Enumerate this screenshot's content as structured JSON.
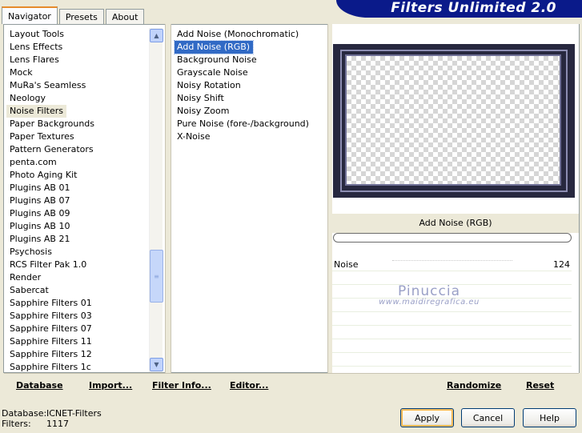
{
  "tabs": [
    {
      "label": "Navigator",
      "active": true
    },
    {
      "label": "Presets",
      "active": false
    },
    {
      "label": "About",
      "active": false
    }
  ],
  "banner": {
    "title": "Filters Unlimited 2.0",
    "color": "#0a1a8a"
  },
  "categories": [
    "Layout Tools",
    "Lens Effects",
    "Lens Flares",
    "Mock",
    "MuRa's Seamless",
    "Neology",
    "Noise Filters",
    "Paper Backgrounds",
    "Paper Textures",
    "Pattern Generators",
    "penta.com",
    "Photo Aging Kit",
    "Plugins AB 01",
    "Plugins AB 07",
    "Plugins AB 09",
    "Plugins AB 10",
    "Plugins AB 21",
    "Psychosis",
    "RCS Filter Pak 1.0",
    "Render",
    "Sabercat",
    "Sapphire Filters 01",
    "Sapphire Filters 03",
    "Sapphire Filters 07",
    "Sapphire Filters 11",
    "Sapphire Filters 12",
    "Sapphire Filters 1c"
  ],
  "selected_category": "Noise Filters",
  "filters": [
    "Add Noise (Monochromatic)",
    "Add Noise (RGB)",
    "Background Noise",
    "Grayscale Noise",
    "Noisy Rotation",
    "Noisy Shift",
    "Noisy Zoom",
    "Pure Noise (fore-/background)",
    "X-Noise"
  ],
  "selected_filter": "Add Noise (RGB)",
  "preview": {
    "current_filter": "Add Noise (RGB)"
  },
  "parameters": [
    {
      "label": "Noise",
      "value": "124"
    }
  ],
  "watermark": {
    "line1": "Pinuccia",
    "line2": "www.maidiregrafica.eu"
  },
  "links": {
    "database": "Database",
    "import": "Import...",
    "filter_info": "Filter Info...",
    "editor": "Editor...",
    "randomize": "Randomize",
    "reset": "Reset"
  },
  "footer": {
    "database_label": "Database:",
    "database_value": "ICNET-Filters",
    "filters_label": "Filters:",
    "filters_value": "1117"
  },
  "buttons": {
    "apply": "Apply",
    "cancel": "Cancel",
    "help": "Help"
  }
}
